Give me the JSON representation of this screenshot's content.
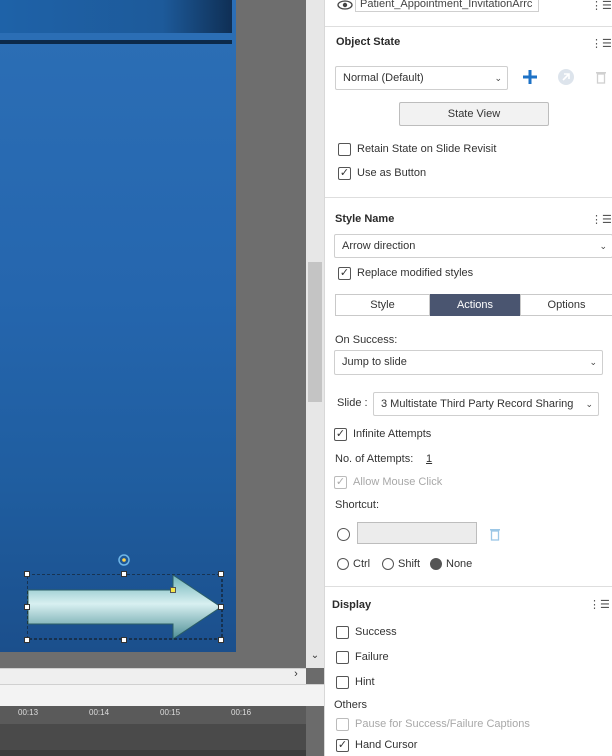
{
  "object_name_value": "Patient_Appointment_InvitationArrc",
  "object_state": {
    "title": "Object State",
    "state_value": "Normal (Default)",
    "state_view_label": "State View",
    "retain_state_label": "Retain State on Slide Revisit",
    "retain_state_checked": false,
    "use_as_button_label": "Use as Button",
    "use_as_button_checked": true
  },
  "style_section": {
    "title": "Style Name",
    "style_value": "Arrow direction",
    "replace_label": "Replace modified styles",
    "replace_checked": true
  },
  "tabs": [
    {
      "label": "Style",
      "active": false
    },
    {
      "label": "Actions",
      "active": true
    },
    {
      "label": "Options",
      "active": false
    }
  ],
  "actions": {
    "on_success_label": "On Success:",
    "on_success_value": "Jump to slide",
    "slide_label": "Slide :",
    "slide_value": "3 Multistate Third Party Record Sharing",
    "infinite_label": "Infinite Attempts",
    "infinite_checked": true,
    "attempts_label": "No. of Attempts:",
    "attempts_value": "1",
    "allow_click_label": "Allow Mouse Click",
    "shortcut_label": "Shortcut:",
    "mod_ctrl": "Ctrl",
    "mod_shift": "Shift",
    "mod_none": "None",
    "mod_selected": "None"
  },
  "display": {
    "title": "Display",
    "success_label": "Success",
    "failure_label": "Failure",
    "hint_label": "Hint",
    "others_label": "Others",
    "pause_label": "Pause for Success/Failure Captions",
    "hand_cursor_label": "Hand Cursor",
    "hand_cursor_checked": true
  },
  "timeline": {
    "ticks": [
      "00:13",
      "00:14",
      "00:15",
      "00:16"
    ]
  },
  "colors": {
    "slide_blue": "#2566ae",
    "tab_active": "#4a5570",
    "add_icon": "#1d72c6"
  },
  "icons": [
    "eye-icon",
    "menu-icon",
    "add-icon",
    "state-link-icon",
    "trash-icon",
    "chevron-down-icon",
    "chevron-right-icon",
    "arrow-shape",
    "rotate-handle-icon"
  ]
}
